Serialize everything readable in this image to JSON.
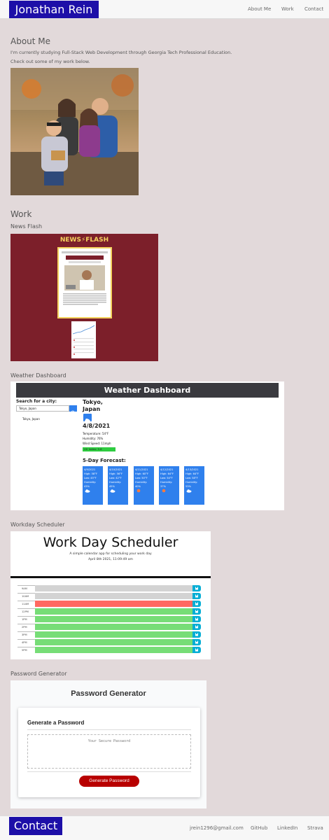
{
  "header": {
    "brand": "Jonathan Rein",
    "nav": [
      "About Me",
      "Work",
      "Contact"
    ]
  },
  "about": {
    "title": "About Me",
    "line1": "I'm currently studying Full-Stack Web Development through Georgia Tech Professional Education.",
    "line2": "Check out some of my work below."
  },
  "work": {
    "title": "Work",
    "news": {
      "label": "News Flash",
      "banner_title": "NEWS",
      "banner_title_2": "FLASH",
      "bolt": "⚡"
    },
    "weather": {
      "label": "Weather Dashboard",
      "header": "Weather Dashboard",
      "search_label": "Search for a city:",
      "search_value": "Tokyo, Japan",
      "history_item": "Tokyo, Japan",
      "city": "Tokyo,",
      "country": "Japan",
      "date": "4/8/2021",
      "temperature": "Temperature: 54°F",
      "humidity": "Humidity: 76%",
      "wind": "Wind Speed: 11mph",
      "uv": "UV Index: 5.6",
      "forecast_title": "5-Day Forecast:",
      "forecast": [
        {
          "date": "4/9/2021",
          "high": "High: 58°F",
          "low": "Low: 45°F",
          "hum_label": "Humidity:",
          "hum": "43%"
        },
        {
          "date": "4/10/2021",
          "high": "High: 56°F",
          "low": "Low: 42°F",
          "hum_label": "Humidity:",
          "hum": "45%"
        },
        {
          "date": "4/11/2021",
          "high": "High: 60°F",
          "low": "Low: 50°F",
          "hum_label": "Humidity:",
          "hum": "40%"
        },
        {
          "date": "4/12/2021",
          "high": "High: 64°F",
          "low": "Low: 54°F",
          "hum_label": "Humidity:",
          "hum": "37%"
        },
        {
          "date": "4/13/2021",
          "high": "High: 64°F",
          "low": "Low: 58°F",
          "hum_label": "Humidity:",
          "hum": "53%"
        }
      ]
    },
    "scheduler": {
      "label": "Workday Scheduler",
      "title": "Work Day Scheduler",
      "subtitle": "A simple calendar app for scheduling your work day",
      "datetime": "April 8th 2021, 11:09:49 am",
      "hours": [
        "9AM",
        "10AM",
        "11AM",
        "12PM",
        "1PM",
        "2PM",
        "3PM",
        "4PM",
        "5PM"
      ],
      "status": [
        "past",
        "past",
        "present",
        "future",
        "future",
        "future",
        "future",
        "future",
        "future"
      ],
      "colors": {
        "past": "#d3d3d3",
        "present": "#ff6961",
        "future": "#77dd77"
      }
    },
    "password": {
      "label": "Password Generator",
      "title": "Password Generator",
      "card_title": "Generate a Password",
      "placeholder": "Your Secure Password",
      "button": "Generate Password"
    }
  },
  "footer": {
    "brand": "Contact",
    "email": "jrein1296@gmail.com",
    "links": [
      "GitHub",
      "LinkedIn",
      "Strava"
    ]
  }
}
